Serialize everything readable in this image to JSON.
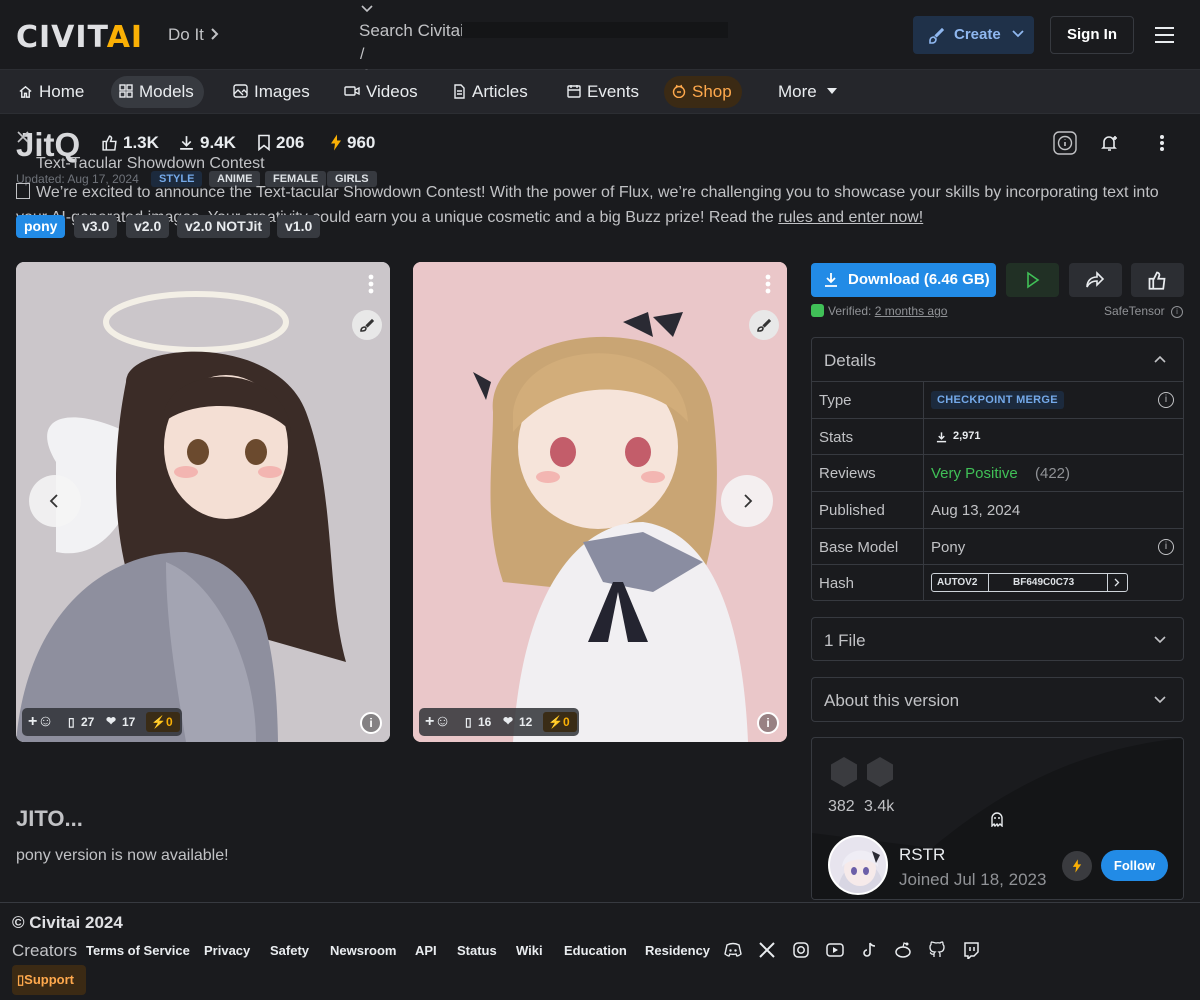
{
  "header": {
    "logo_main": "CIVIT",
    "logo_accent": "AI",
    "doit": "Do It",
    "search_placeholder": "Search Civitai",
    "search_hotkey": "/",
    "create_label": "Create",
    "signin_label": "Sign In"
  },
  "nav": {
    "items": [
      {
        "label": "Home",
        "icon": "home-icon"
      },
      {
        "label": "Models",
        "icon": "grid-icon",
        "active": true
      },
      {
        "label": "Images",
        "icon": "photo-icon"
      },
      {
        "label": "Videos",
        "icon": "video-icon"
      },
      {
        "label": "Articles",
        "icon": "article-icon"
      },
      {
        "label": "Events",
        "icon": "calendar-icon"
      },
      {
        "label": "Shop",
        "icon": "shop-icon"
      },
      {
        "label": "More",
        "icon": "caret-down-icon"
      }
    ]
  },
  "model": {
    "title": "JitQ",
    "likes": "1.3K",
    "downloads": "9.4K",
    "bookmarks": "206",
    "buzz": "960",
    "updated": "Updated: Aug 17, 2024",
    "tags": [
      "STYLE",
      "ANIME",
      "FEMALE",
      "GIRLS"
    ],
    "versions": [
      "pony",
      "v3.0",
      "v2.0",
      "v2.0 NOTJit",
      "v1.0"
    ]
  },
  "announcement": {
    "title": "Text-Tacular Showdown Contest",
    "body": "We’re excited to announce the Text-tacular Showdown Contest! With the power of Flux, we’re challenging you to showcase your skills by incorporating text into your AI-generated images. Your creativity could earn you a unique cosmetic and a big Buzz prize! Read the",
    "link": "rules and enter now!"
  },
  "gallery": [
    {
      "comments": "27",
      "hearts": "17",
      "buzz": "0"
    },
    {
      "comments": "16",
      "hearts": "12",
      "buzz": "0"
    }
  ],
  "description": {
    "title": "JITO...",
    "text": "pony version is now available!"
  },
  "download": {
    "label": "Download (6.46 GB)",
    "verified_prefix": "Verified:",
    "verified_when": "2 months ago",
    "format": "SafeTensor"
  },
  "details": {
    "heading": "Details",
    "rows": [
      {
        "key": "Type",
        "value": "CHECKPOINT MERGE"
      },
      {
        "key": "Stats",
        "value": "2,971"
      },
      {
        "key": "Reviews",
        "value": "Very Positive",
        "extra": "(422)"
      },
      {
        "key": "Published",
        "value": "Aug 13, 2024"
      },
      {
        "key": "Base Model",
        "value": "Pony"
      },
      {
        "key": "Hash",
        "value": "AUTOV2",
        "extra": "BF649C0C73"
      }
    ]
  },
  "files": {
    "heading": "1 File"
  },
  "about": {
    "heading": "About this version"
  },
  "creator": {
    "stat_a": "382",
    "stat_b": "3.4k",
    "name": "RSTR",
    "joined": "Joined Jul 18, 2023",
    "follow_label": "Follow"
  },
  "footer": {
    "copyright": "© Civitai 2024",
    "creators": "Creators",
    "links": [
      "Terms of Service",
      "Privacy",
      "Safety",
      "Newsroom",
      "API",
      "Status",
      "Wiki",
      "Education",
      "Residency"
    ],
    "support": "Support"
  },
  "colors": {
    "accent": "#228be6",
    "buzz": "#fab005",
    "positive": "#40c057"
  }
}
